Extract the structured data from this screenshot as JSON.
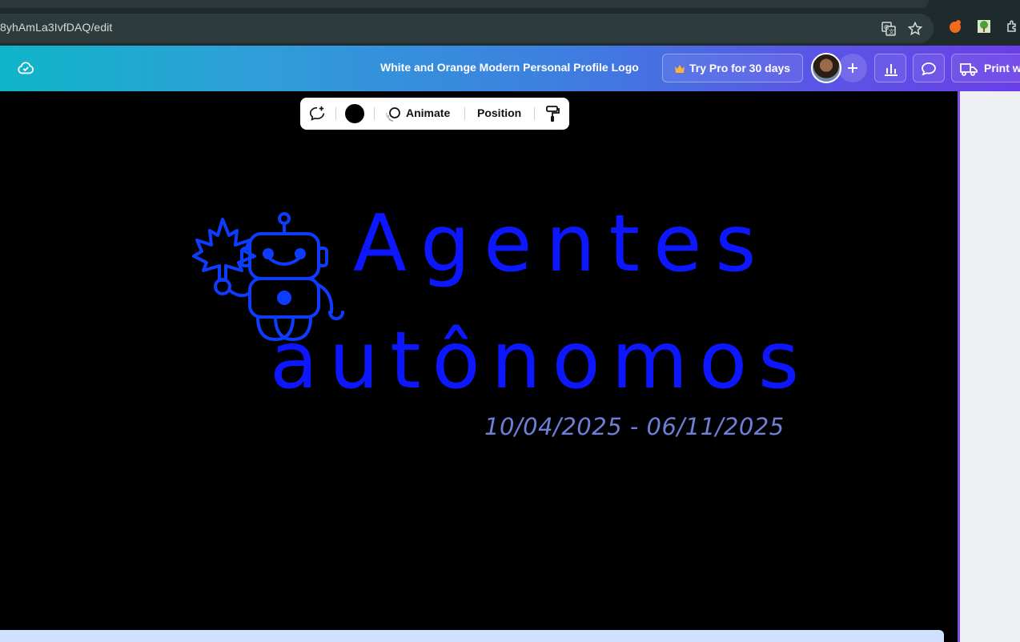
{
  "browser": {
    "url": "8yhAmLa3IvfDAQ/edit",
    "icons": [
      "translate-icon",
      "bookmark-star-icon",
      "extension-orange-icon",
      "extension-tree-icon",
      "extensions-puzzle-icon"
    ]
  },
  "header": {
    "title": "White and Orange Modern Personal Profile Logo",
    "try_pro_label": "Try Pro for 30 days",
    "print_label": "Print w",
    "icons": [
      "cloud-saved-icon",
      "crown-icon",
      "avatar",
      "add-icon",
      "insights-icon",
      "comment-icon",
      "print-truck-icon"
    ]
  },
  "toolbar": {
    "animate_label": "Animate",
    "position_label": "Position",
    "swatch_color": "#000000",
    "icons": [
      "ai-edit-icon",
      "animate-icon",
      "paint-roller-icon"
    ]
  },
  "canvas": {
    "line1": "Agentes",
    "line2": "autônomos",
    "date_range": "10/04/2025 - 06/11/2025",
    "text_color": "#0d17ff",
    "date_color": "#6f7fd8",
    "background": "#000000"
  }
}
